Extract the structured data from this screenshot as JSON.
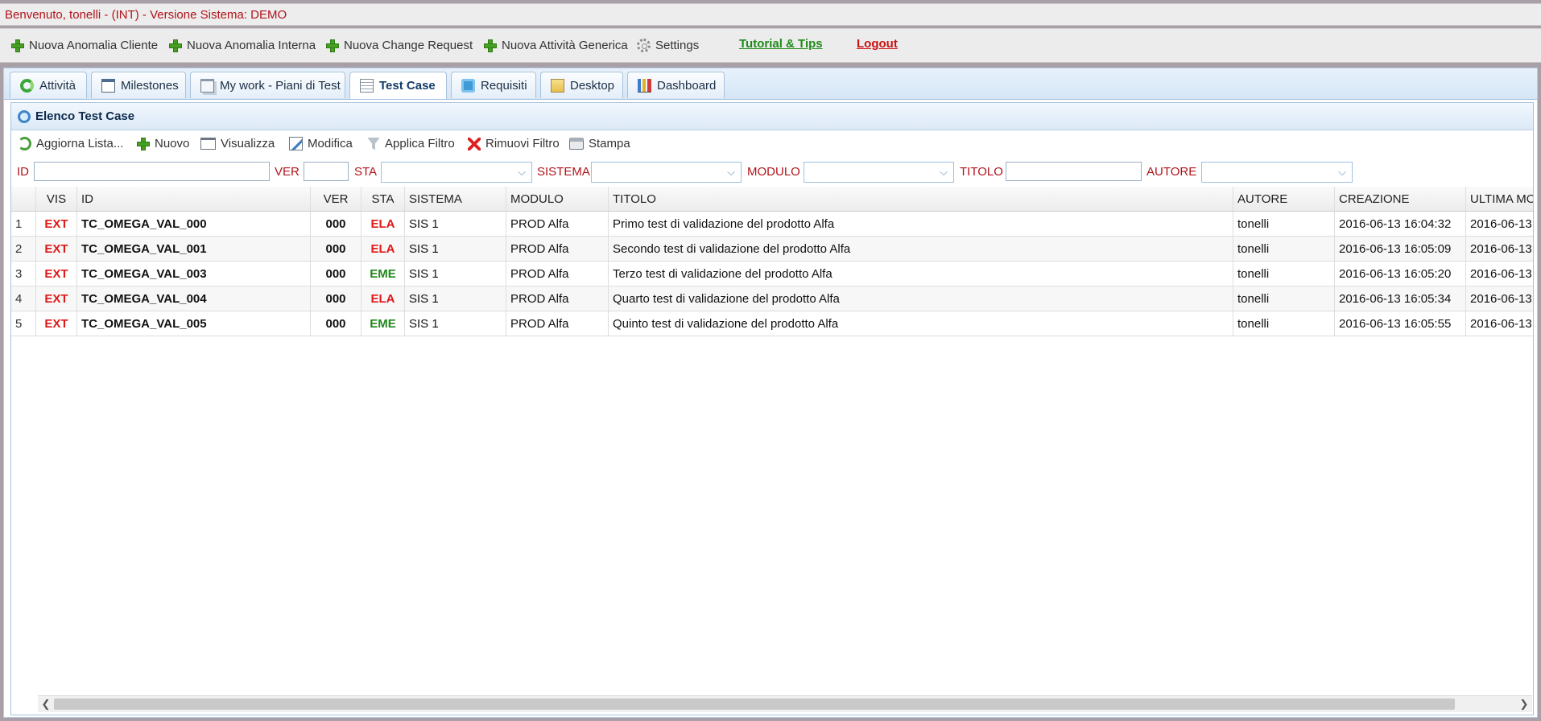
{
  "header": {
    "welcome": "Benvenuto, tonelli - (INT) - Versione Sistema: DEMO"
  },
  "actions": {
    "nuova_anomalia_cliente": "Nuova Anomalia Cliente",
    "nuova_anomalia_interna": "Nuova Anomalia Interna",
    "nuova_change_request": "Nuova Change Request",
    "nuova_attivita_generica": "Nuova Attività Generica",
    "settings": "Settings",
    "tutorial": "Tutorial & Tips",
    "logout": "Logout"
  },
  "tabs": [
    {
      "label": "Attività",
      "icon": "recycle-icon"
    },
    {
      "label": "Milestones",
      "icon": "calendar-icon"
    },
    {
      "label": "My work - Piani di Test",
      "icon": "windows-icon"
    },
    {
      "label": "Test Case",
      "icon": "list-icon",
      "active": true
    },
    {
      "label": "Requisiti",
      "icon": "puzzle-icon"
    },
    {
      "label": "Desktop",
      "icon": "folder-icon"
    },
    {
      "label": "Dashboard",
      "icon": "bar-chart-icon"
    }
  ],
  "list": {
    "title": "Elenco Test Case"
  },
  "toolbar": {
    "aggiorna": "Aggiorna Lista...",
    "nuovo": "Nuovo",
    "visualizza": "Visualizza",
    "modifica": "Modifica",
    "applica_filtro": "Applica Filtro",
    "rimuovi_filtro": "Rimuovi Filtro",
    "stampa": "Stampa"
  },
  "filters": {
    "id": "ID",
    "ver": "VER",
    "sta": "STA",
    "sistema": "SISTEMA",
    "modulo": "MODULO",
    "titolo": "TITOLO",
    "autore": "AUTORE"
  },
  "table": {
    "columns": {
      "vis": "VIS",
      "id": "ID",
      "ver": "VER",
      "sta": "STA",
      "sistema": "SISTEMA",
      "modulo": "MODULO",
      "titolo": "TITOLO",
      "autore": "AUTORE",
      "creazione": "CREAZIONE",
      "ultima": "ULTIMA MOD"
    },
    "rows": [
      {
        "n": "1",
        "vis": "EXT",
        "id": "TC_OMEGA_VAL_000",
        "ver": "000",
        "sta": "ELA",
        "sistema": "SIS 1",
        "modulo": "PROD Alfa",
        "titolo": "Primo test di validazione del prodotto Alfa",
        "autore": "tonelli",
        "creazione": "2016-06-13 16:04:32",
        "ultima": "2016-06-13"
      },
      {
        "n": "2",
        "vis": "EXT",
        "id": "TC_OMEGA_VAL_001",
        "ver": "000",
        "sta": "ELA",
        "sistema": "SIS 1",
        "modulo": "PROD Alfa",
        "titolo": "Secondo test di validazione del prodotto Alfa",
        "autore": "tonelli",
        "creazione": "2016-06-13 16:05:09",
        "ultima": "2016-06-13"
      },
      {
        "n": "3",
        "vis": "EXT",
        "id": "TC_OMEGA_VAL_003",
        "ver": "000",
        "sta": "EME",
        "sistema": "SIS 1",
        "modulo": "PROD Alfa",
        "titolo": "Terzo test di validazione del prodotto Alfa",
        "autore": "tonelli",
        "creazione": "2016-06-13 16:05:20",
        "ultima": "2016-06-13"
      },
      {
        "n": "4",
        "vis": "EXT",
        "id": "TC_OMEGA_VAL_004",
        "ver": "000",
        "sta": "ELA",
        "sistema": "SIS 1",
        "modulo": "PROD Alfa",
        "titolo": "Quarto test di validazione del prodotto Alfa",
        "autore": "tonelli",
        "creazione": "2016-06-13 16:05:34",
        "ultima": "2016-06-13"
      },
      {
        "n": "5",
        "vis": "EXT",
        "id": "TC_OMEGA_VAL_005",
        "ver": "000",
        "sta": "EME",
        "sistema": "SIS 1",
        "modulo": "PROD Alfa",
        "titolo": "Quinto test di validazione del prodotto Alfa",
        "autore": "tonelli",
        "creazione": "2016-06-13 16:05:55",
        "ultima": "2016-06-13"
      }
    ]
  },
  "colors": {
    "status_ela": "#e01818",
    "status_eme": "#22871c",
    "label_red": "#b0131a",
    "tutorial_green": "#1f8a17",
    "logout_red": "#cc1111"
  }
}
